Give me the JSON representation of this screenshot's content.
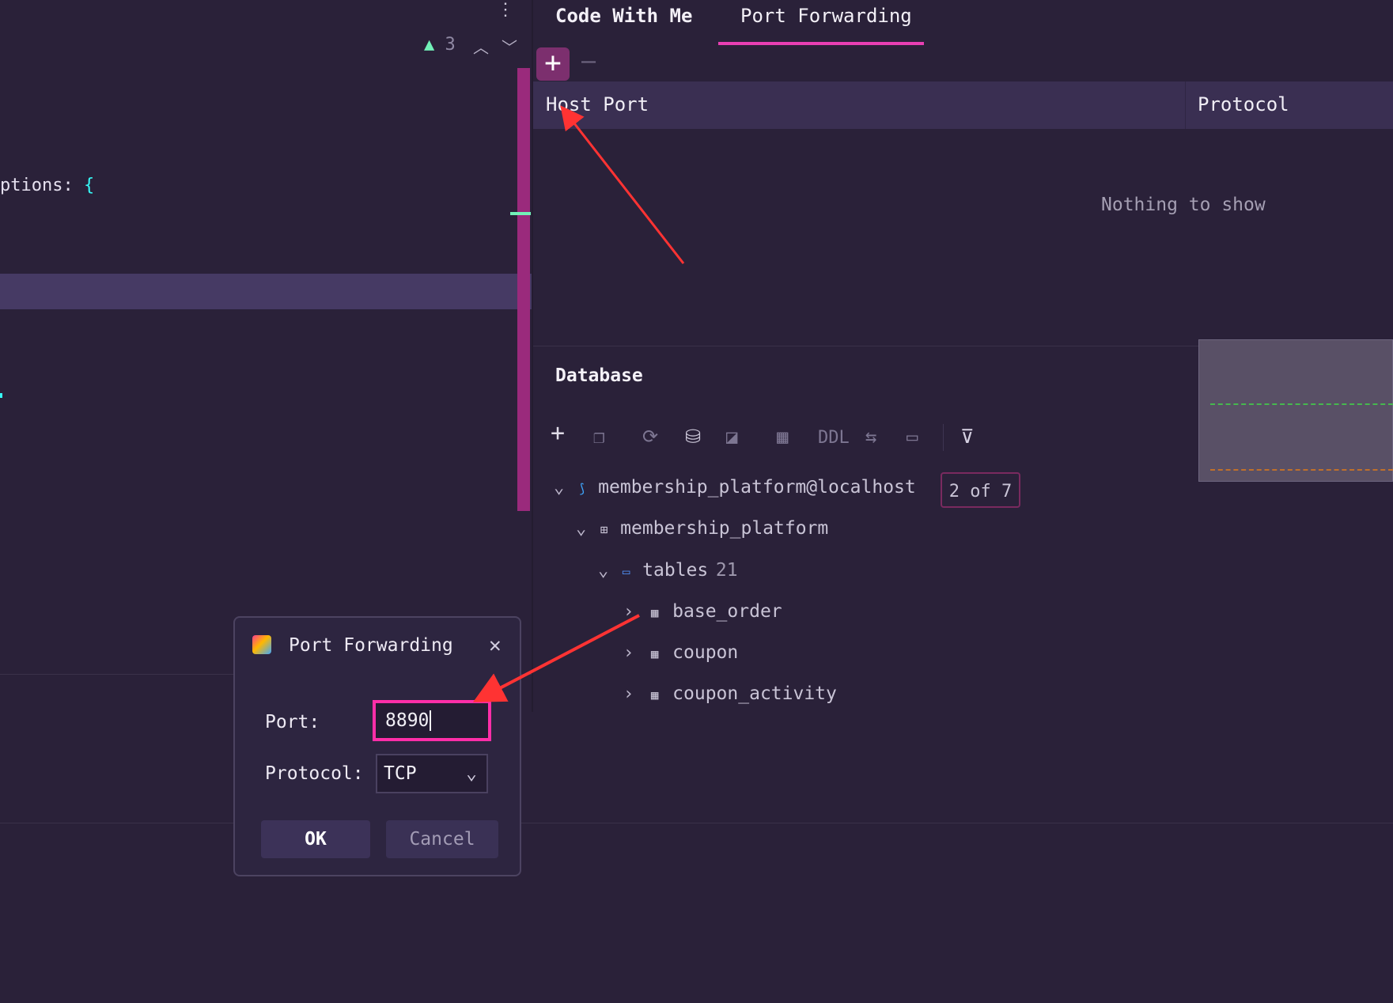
{
  "editor": {
    "code_line_1": "ptions:",
    "code_brace": "{",
    "warning_count": "3"
  },
  "tabs": [
    {
      "label": "Code With Me"
    },
    {
      "label": "Port Forwarding"
    }
  ],
  "port_forwarding": {
    "add_label": "+",
    "remove_label": "—",
    "columns": [
      "Host Port",
      "Protocol"
    ],
    "empty_text": "Nothing to show"
  },
  "database": {
    "title": "Database",
    "toolbar_ddl": "DDL",
    "connection": "membership_platform@localhost",
    "connection_badge": "2 of 7",
    "schema": "membership_platform",
    "tables_folder": "tables",
    "tables_count": "21",
    "tables": [
      "base_order",
      "coupon",
      "coupon_activity"
    ]
  },
  "dialog": {
    "title": "Port Forwarding",
    "port_label": "Port:",
    "port_value": "8890",
    "protocol_label": "Protocol:",
    "protocol_value": "TCP",
    "ok_label": "OK",
    "cancel_label": "Cancel"
  },
  "colors": {
    "background": "#2a2139",
    "accent_pink": "#e83fb3",
    "annotation_red": "#ff3333"
  }
}
